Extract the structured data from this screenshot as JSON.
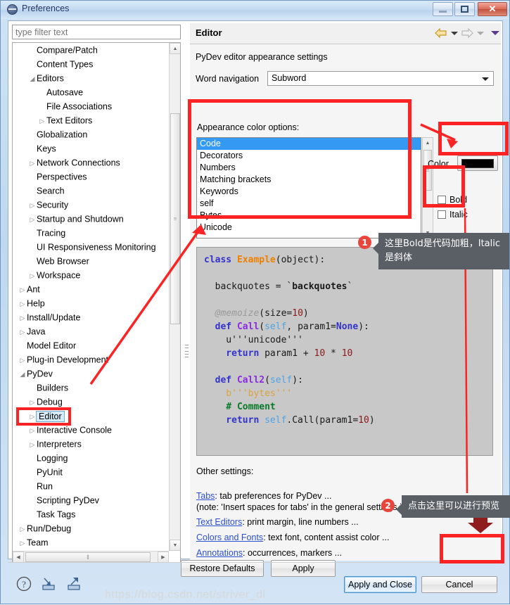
{
  "window": {
    "title": "Preferences",
    "buttons": {
      "minimize": "minimize",
      "maximize": "maximize",
      "close": "✕"
    }
  },
  "filter": {
    "placeholder": "type filter text",
    "value": ""
  },
  "tree": {
    "items": [
      {
        "label": "Compare/Patch",
        "indent": 1,
        "twisty": "",
        "selected": false
      },
      {
        "label": "Content Types",
        "indent": 1,
        "twisty": "",
        "selected": false
      },
      {
        "label": "Editors",
        "indent": 1,
        "twisty": "◢",
        "selected": false
      },
      {
        "label": "Autosave",
        "indent": 2,
        "twisty": "",
        "selected": false
      },
      {
        "label": "File Associations",
        "indent": 2,
        "twisty": "",
        "selected": false
      },
      {
        "label": "Text Editors",
        "indent": 2,
        "twisty": "▷",
        "selected": false
      },
      {
        "label": "Globalization",
        "indent": 1,
        "twisty": "",
        "selected": false
      },
      {
        "label": "Keys",
        "indent": 1,
        "twisty": "",
        "selected": false
      },
      {
        "label": "Network Connections",
        "indent": 1,
        "twisty": "▷",
        "selected": false
      },
      {
        "label": "Perspectives",
        "indent": 1,
        "twisty": "",
        "selected": false
      },
      {
        "label": "Search",
        "indent": 1,
        "twisty": "",
        "selected": false
      },
      {
        "label": "Security",
        "indent": 1,
        "twisty": "▷",
        "selected": false
      },
      {
        "label": "Startup and Shutdown",
        "indent": 1,
        "twisty": "▷",
        "selected": false
      },
      {
        "label": "Tracing",
        "indent": 1,
        "twisty": "",
        "selected": false
      },
      {
        "label": "UI Responsiveness Monitoring",
        "indent": 1,
        "twisty": "",
        "selected": false
      },
      {
        "label": "Web Browser",
        "indent": 1,
        "twisty": "",
        "selected": false
      },
      {
        "label": "Workspace",
        "indent": 1,
        "twisty": "▷",
        "selected": false
      },
      {
        "label": "Ant",
        "indent": 0,
        "twisty": "▷",
        "selected": false
      },
      {
        "label": "Help",
        "indent": 0,
        "twisty": "▷",
        "selected": false
      },
      {
        "label": "Install/Update",
        "indent": 0,
        "twisty": "▷",
        "selected": false
      },
      {
        "label": "Java",
        "indent": 0,
        "twisty": "▷",
        "selected": false
      },
      {
        "label": "Model Editor",
        "indent": 0,
        "twisty": "",
        "selected": false
      },
      {
        "label": "Plug-in Development",
        "indent": 0,
        "twisty": "▷",
        "selected": false
      },
      {
        "label": "PyDev",
        "indent": 0,
        "twisty": "◢",
        "selected": false
      },
      {
        "label": "Builders",
        "indent": 1,
        "twisty": "",
        "selected": false
      },
      {
        "label": "Debug",
        "indent": 1,
        "twisty": "▷",
        "selected": false
      },
      {
        "label": "Editor",
        "indent": 1,
        "twisty": "▷",
        "selected": true
      },
      {
        "label": "Interactive Console",
        "indent": 1,
        "twisty": "▷",
        "selected": false
      },
      {
        "label": "Interpreters",
        "indent": 1,
        "twisty": "▷",
        "selected": false
      },
      {
        "label": "Logging",
        "indent": 1,
        "twisty": "",
        "selected": false
      },
      {
        "label": "PyUnit",
        "indent": 1,
        "twisty": "",
        "selected": false
      },
      {
        "label": "Run",
        "indent": 1,
        "twisty": "",
        "selected": false
      },
      {
        "label": "Scripting PyDev",
        "indent": 1,
        "twisty": "",
        "selected": false
      },
      {
        "label": "Task Tags",
        "indent": 1,
        "twisty": "",
        "selected": false
      },
      {
        "label": "Run/Debug",
        "indent": 0,
        "twisty": "▷",
        "selected": false
      },
      {
        "label": "Team",
        "indent": 0,
        "twisty": "▷",
        "selected": false
      }
    ]
  },
  "page": {
    "title": "Editor",
    "description": "PyDev editor appearance settings",
    "word_navigation": {
      "label": "Word navigation",
      "value": "Subword"
    },
    "appearance": {
      "label": "Appearance color options:",
      "options": [
        "Code",
        "Decorators",
        "Numbers",
        "Matching brackets",
        "Keywords",
        "self",
        "Bytes",
        "Unicode"
      ],
      "selected": "Code"
    },
    "color": {
      "label": "Color",
      "value": "#000000"
    },
    "bold": {
      "label": "Bold",
      "checked": false
    },
    "italic": {
      "label": "Italic",
      "checked": false
    },
    "preview": {
      "lines": [
        [
          {
            "t": "class ",
            "c": "k-class"
          },
          {
            "t": "Example",
            "c": "k-cname"
          },
          {
            "t": "(object):",
            "c": "k-plain"
          }
        ],
        [
          {
            "t": "",
            "c": "k-plain"
          }
        ],
        [
          {
            "t": "  backquotes = `",
            "c": "k-plain"
          },
          {
            "t": "backquotes",
            "c": "k-bold"
          },
          {
            "t": "`",
            "c": "k-plain"
          }
        ],
        [
          {
            "t": "",
            "c": "k-plain"
          }
        ],
        [
          {
            "t": "  @memoize",
            "c": "k-deco"
          },
          {
            "t": "(size=",
            "c": "k-plain"
          },
          {
            "t": "10",
            "c": "k-num"
          },
          {
            "t": ")",
            "c": "k-plain"
          }
        ],
        [
          {
            "t": "  def ",
            "c": "k-kw"
          },
          {
            "t": "Call",
            "c": "k-fn"
          },
          {
            "t": "(",
            "c": "k-plain"
          },
          {
            "t": "self",
            "c": "k-self"
          },
          {
            "t": ", param1=",
            "c": "k-plain"
          },
          {
            "t": "None",
            "c": "k-kw"
          },
          {
            "t": "):",
            "c": "k-plain"
          }
        ],
        [
          {
            "t": "    u'''unicode'''",
            "c": "k-unicode"
          }
        ],
        [
          {
            "t": "    return ",
            "c": "k-kw"
          },
          {
            "t": "param1 + ",
            "c": "k-plain"
          },
          {
            "t": "10",
            "c": "k-num"
          },
          {
            "t": " * ",
            "c": "k-plain"
          },
          {
            "t": "10",
            "c": "k-num"
          }
        ],
        [
          {
            "t": "",
            "c": "k-plain"
          }
        ],
        [
          {
            "t": "  def ",
            "c": "k-kw"
          },
          {
            "t": "Call2",
            "c": "k-fn"
          },
          {
            "t": "(",
            "c": "k-plain"
          },
          {
            "t": "self",
            "c": "k-self"
          },
          {
            "t": "):",
            "c": "k-plain"
          }
        ],
        [
          {
            "t": "    b'''bytes'''",
            "c": "k-bytes"
          }
        ],
        [
          {
            "t": "    # Comment",
            "c": "k-comment"
          }
        ],
        [
          {
            "t": "    return ",
            "c": "k-kw"
          },
          {
            "t": "self",
            "c": "k-self"
          },
          {
            "t": ".Call(param1=",
            "c": "k-plain"
          },
          {
            "t": "10",
            "c": "k-num"
          },
          {
            "t": ")",
            "c": "k-plain"
          }
        ]
      ]
    },
    "other_settings": {
      "label": "Other settings:",
      "lines": [
        {
          "link": "Tabs",
          "rest": ": tab preferences for PyDev ..."
        },
        {
          "link": "",
          "rest": "(note: 'Insert spaces for tabs' in the general settings is ignored)."
        },
        {
          "link": "Text Editors",
          "rest": ": print margin, line numbers ..."
        },
        {
          "link": "Colors and Fonts",
          "rest": ": text font, content assist color ..."
        },
        {
          "link": "Annotations",
          "rest": ": occurrences, markers ..."
        }
      ]
    },
    "buttons": {
      "restore_defaults": "Restore Defaults",
      "apply": "Apply",
      "apply_and_close": "Apply and Close",
      "cancel": "Cancel"
    }
  },
  "annotations": {
    "badge1": "1",
    "tip1": "这里Bold是代码加粗，Italic是斜体",
    "badge2": "2",
    "tip2": "点击这里可以进行预览",
    "highlight_color": "#fb2323"
  },
  "watermark": "https://blog.csdn.net/striver_dl"
}
